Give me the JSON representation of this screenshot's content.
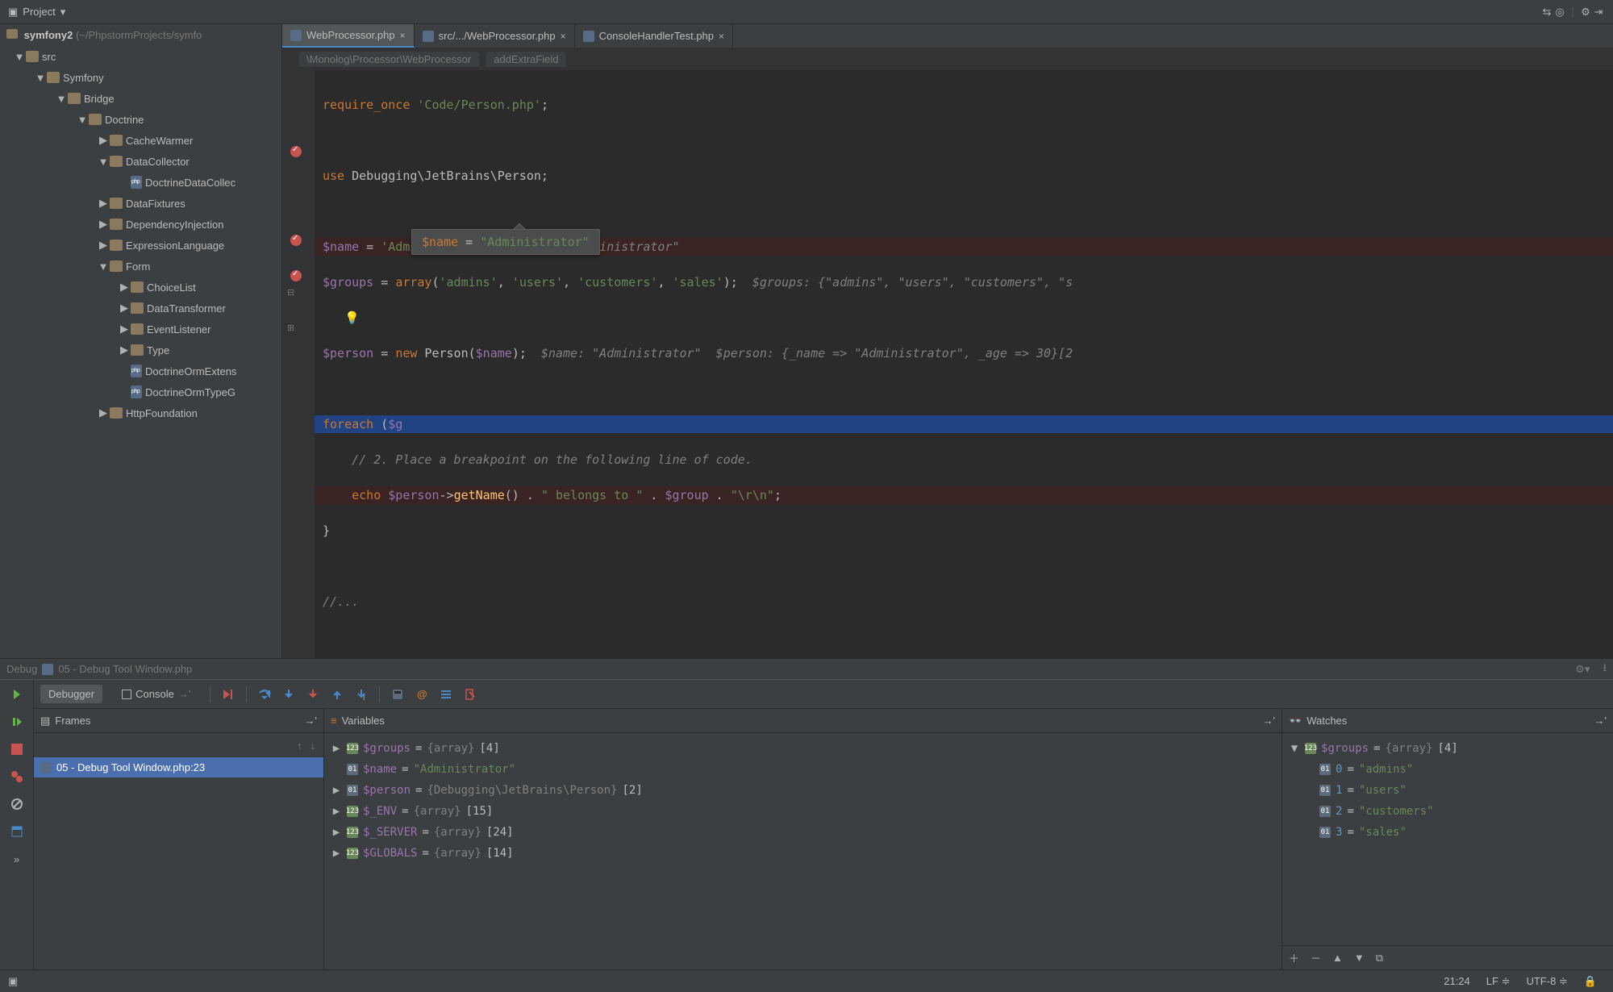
{
  "topbar": {
    "project_label": "Project"
  },
  "project": {
    "root_name": "symfony2",
    "root_path": "(~/PhpstormProjects/symfo",
    "tree": [
      {
        "depth": 0,
        "arrow": "▼",
        "type": "folder",
        "label": "src"
      },
      {
        "depth": 1,
        "arrow": "▼",
        "type": "folder",
        "label": "Symfony"
      },
      {
        "depth": 2,
        "arrow": "▼",
        "type": "folder",
        "label": "Bridge"
      },
      {
        "depth": 3,
        "arrow": "▼",
        "type": "folder",
        "label": "Doctrine"
      },
      {
        "depth": 4,
        "arrow": "▶",
        "type": "folder",
        "label": "CacheWarmer"
      },
      {
        "depth": 4,
        "arrow": "▼",
        "type": "folder",
        "label": "DataCollector"
      },
      {
        "depth": 5,
        "arrow": "",
        "type": "file",
        "label": "DoctrineDataCollec"
      },
      {
        "depth": 4,
        "arrow": "▶",
        "type": "folder",
        "label": "DataFixtures"
      },
      {
        "depth": 4,
        "arrow": "▶",
        "type": "folder",
        "label": "DependencyInjection"
      },
      {
        "depth": 4,
        "arrow": "▶",
        "type": "folder",
        "label": "ExpressionLanguage"
      },
      {
        "depth": 4,
        "arrow": "▼",
        "type": "folder",
        "label": "Form"
      },
      {
        "depth": 5,
        "arrow": "▶",
        "type": "folder",
        "label": "ChoiceList"
      },
      {
        "depth": 5,
        "arrow": "▶",
        "type": "folder",
        "label": "DataTransformer"
      },
      {
        "depth": 5,
        "arrow": "▶",
        "type": "folder",
        "label": "EventListener"
      },
      {
        "depth": 5,
        "arrow": "▶",
        "type": "folder",
        "label": "Type"
      },
      {
        "depth": 5,
        "arrow": "",
        "type": "file",
        "label": "DoctrineOrmExtens"
      },
      {
        "depth": 5,
        "arrow": "",
        "type": "file",
        "label": "DoctrineOrmTypeG"
      },
      {
        "depth": 4,
        "arrow": "▶",
        "type": "folder",
        "label": "HttpFoundation"
      }
    ]
  },
  "tabs": [
    {
      "label": "WebProcessor.php",
      "active": true
    },
    {
      "label": "src/.../WebProcessor.php",
      "active": false
    },
    {
      "label": "ConsoleHandlerTest.php",
      "active": false
    }
  ],
  "breadcrumb": {
    "path": "\\Monolog\\Processor\\WebProcessor",
    "member": "addExtraField"
  },
  "tooltip": {
    "var": "$name",
    "eq": " = ",
    "val": "\"Administrator\""
  },
  "debug_tab_label": "Debug",
  "debug_file_label": "05 - Debug Tool Window.php",
  "debugger_tabs": {
    "debugger": "Debugger",
    "console": "Console"
  },
  "frames": {
    "title": "Frames",
    "rows": [
      {
        "label": "05 - Debug Tool Window.php:23",
        "selected": true
      }
    ]
  },
  "variables": {
    "title": "Variables",
    "rows": [
      {
        "arrow": "▶",
        "icon": "123",
        "name": "$groups",
        "eq": " = ",
        "type": "{array} ",
        "extra": "[4]"
      },
      {
        "arrow": "",
        "icon": "01",
        "name": "$name",
        "eq": " = ",
        "str": "\"Administrator\""
      },
      {
        "arrow": "▶",
        "icon": "01",
        "name": "$person",
        "eq": " = ",
        "type": "{Debugging\\JetBrains\\Person} ",
        "extra": "[2]"
      },
      {
        "arrow": "▶",
        "icon": "123",
        "name": "$_ENV",
        "eq": " = ",
        "type": "{array} ",
        "extra": "[15]"
      },
      {
        "arrow": "▶",
        "icon": "123",
        "name": "$_SERVER",
        "eq": " = ",
        "type": "{array} ",
        "extra": "[24]"
      },
      {
        "arrow": "▶",
        "icon": "123",
        "name": "$GLOBALS",
        "eq": " = ",
        "type": "{array} ",
        "extra": "[14]"
      }
    ]
  },
  "watches": {
    "title": "Watches",
    "root": {
      "arrow": "▼",
      "icon": "123",
      "name": "$groups",
      "eq": " = ",
      "type": "{array} ",
      "extra": "[4]"
    },
    "items": [
      {
        "key": "0",
        "val": "\"admins\""
      },
      {
        "key": "1",
        "val": "\"users\""
      },
      {
        "key": "2",
        "val": "\"customers\""
      },
      {
        "key": "3",
        "val": "\"sales\""
      }
    ]
  },
  "status": {
    "pos": "21:24",
    "linesep": "LF ≑",
    "encoding": "UTF-8 ≑"
  }
}
